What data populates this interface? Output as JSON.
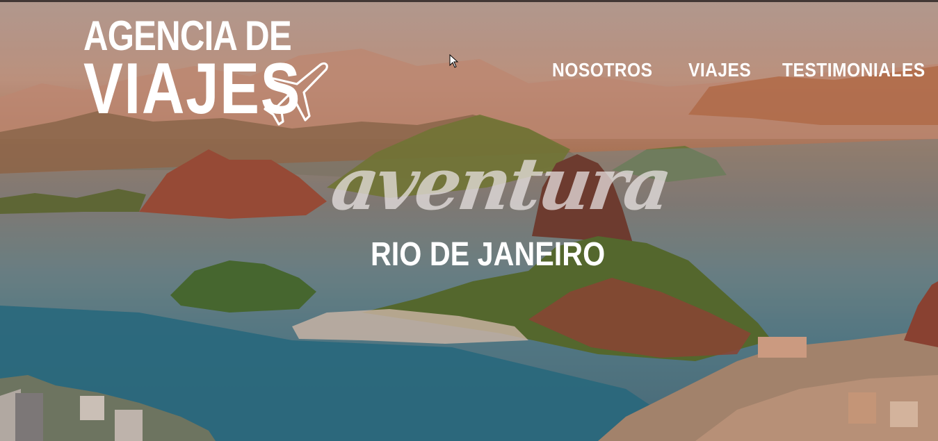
{
  "logo": {
    "line1": "AGENCIA DE",
    "line2": "VIAJES",
    "icon": "airplane-icon"
  },
  "nav": {
    "items": [
      "NOSOTROS",
      "VIAJES",
      "TESTIMONIALES"
    ]
  },
  "hero": {
    "tagline": "aventura",
    "destination": "RIO DE JANEIRO"
  },
  "colors": {
    "text": "#ffffff",
    "overlay_warm": "#c49a86",
    "water": "#2f6f86"
  }
}
